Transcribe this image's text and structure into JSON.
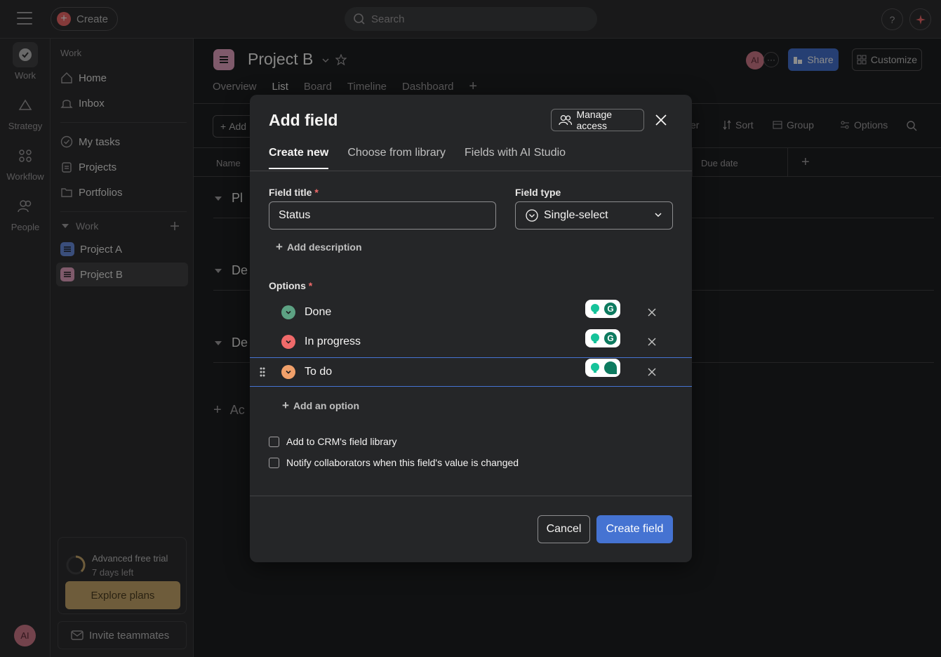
{
  "topbar": {
    "create_label": "Create",
    "search_placeholder": "Search",
    "help_label": "?"
  },
  "rail": {
    "items": [
      {
        "label": "Work",
        "icon": "check-circle-icon"
      },
      {
        "label": "Strategy",
        "icon": "triangle-icon"
      },
      {
        "label": "Workflow",
        "icon": "workflow-icon"
      },
      {
        "label": "People",
        "icon": "people-icon"
      }
    ],
    "avatar_initials": "AI"
  },
  "sidebar": {
    "section_label": "Work",
    "home": "Home",
    "inbox": "Inbox",
    "my_tasks": "My tasks",
    "projects": "Projects",
    "portfolios": "Portfolios",
    "work_group_label": "Work",
    "project_a": "Project A",
    "project_b": "Project B",
    "trial_title": "Advanced free trial",
    "trial_days": "7 days left",
    "explore_label": "Explore plans",
    "invite_label": "Invite teammates"
  },
  "main": {
    "project_title": "Project B",
    "tabs": [
      "Overview",
      "List",
      "Board",
      "Timeline",
      "Dashboard"
    ],
    "active_tab": "List",
    "avatar_initials": "AI",
    "share_label": "Share",
    "customize_label": "Customize",
    "add_label": "Add",
    "toolbar": {
      "filter_partial": "er",
      "sort": "Sort",
      "group": "Group",
      "options": "Options"
    },
    "columns": {
      "name": "Name",
      "due_date": "Due date"
    },
    "sections": [
      "Pl",
      "De",
      "De",
      "Ac"
    ]
  },
  "modal": {
    "title": "Add field",
    "manage_access_label": "Manage access",
    "tabs": [
      "Create new",
      "Choose from library",
      "Fields with AI Studio"
    ],
    "active_tab": "Create new",
    "field_title_label": "Field title",
    "field_title_value": "Status",
    "field_type_label": "Field type",
    "field_type_value": "Single-select",
    "add_description_label": "Add description",
    "options_label": "Options",
    "required_mark": "*",
    "options": [
      {
        "label": "Done",
        "color": "#5da283"
      },
      {
        "label": "In progress",
        "color": "#f06a6a"
      },
      {
        "label": "To do",
        "color": "#f1a06a"
      }
    ],
    "add_option_label": "Add an option",
    "checkbox_library_label": "Add to CRM's field library",
    "checkbox_notify_label": "Notify collaborators when this field's value is changed",
    "cancel_label": "Cancel",
    "create_label": "Create field"
  },
  "colors": {
    "accent": "#4573d2",
    "danger": "#f06a6a",
    "done": "#5da283",
    "todo": "#f1a06a"
  }
}
